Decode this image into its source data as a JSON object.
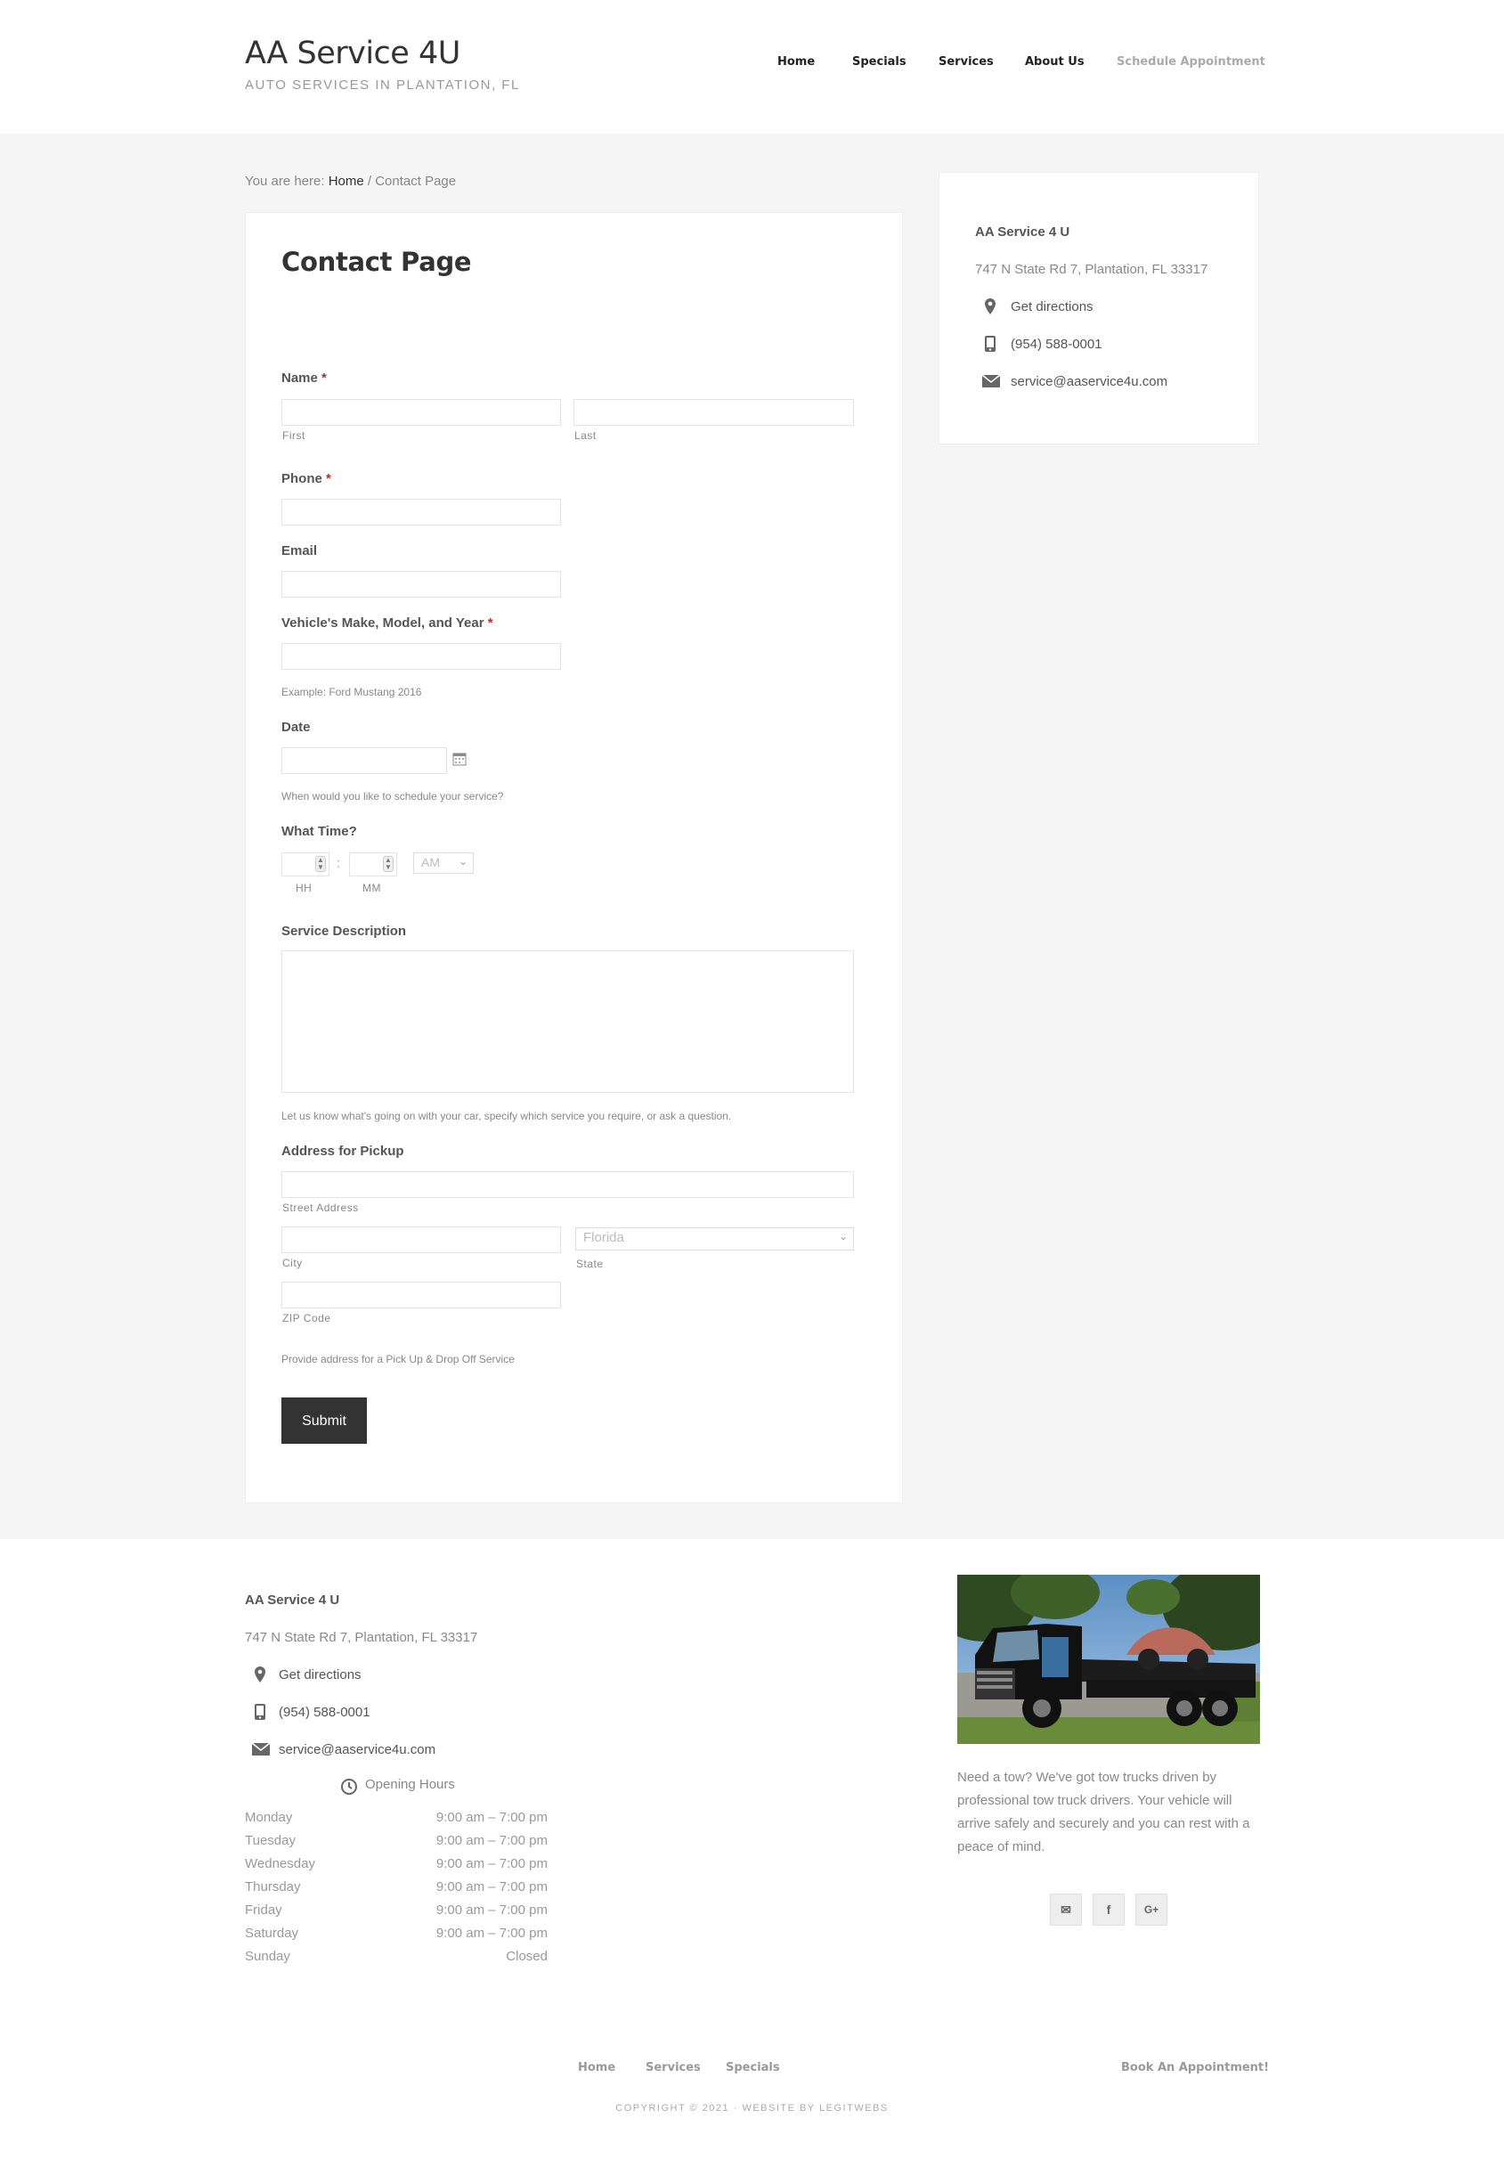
{
  "site": {
    "title": "AA Service 4U",
    "description": "AUTO SERVICES IN PLANTATION, FL"
  },
  "nav": {
    "items": [
      "Home",
      "Specials",
      "Services",
      "About Us",
      "Schedule Appointment"
    ]
  },
  "breadcrumb": {
    "prefix": "You are here: ",
    "home": "Home",
    "separator": " / ",
    "current": "Contact Page"
  },
  "page": {
    "title": "Contact Page"
  },
  "form": {
    "name_label": "Name",
    "required_mark": "*",
    "first_sub": "First",
    "last_sub": "Last",
    "phone_label": "Phone",
    "email_label": "Email",
    "vehicle_label": "Vehicle's Make, Model, and Year",
    "vehicle_hint": "Example: Ford Mustang 2016",
    "date_label": "Date",
    "date_hint": "When would you like to schedule your service?",
    "time_label": "What Time?",
    "time_separator": ":",
    "hh_sub": "HH",
    "mm_sub": "MM",
    "ampm_value": "AM",
    "desc_label": "Service Description",
    "desc_hint": "Let us know what's going on with your car, specify which service you require, or ask a question.",
    "address_label": "Address for Pickup",
    "street_sub": "Street Address",
    "city_sub": "City",
    "state_sub": "State",
    "state_value": "Florida",
    "zip_sub": "ZIP Code",
    "address_hint": "Provide address for a Pick Up & Drop Off Service",
    "submit_label": "Submit"
  },
  "business": {
    "name": "AA Service 4 U",
    "address": "747 N State Rd 7, Plantation, FL 33317",
    "directions": "Get directions",
    "phone": "(954) 588-0001",
    "email": "service@aaservice4u.com"
  },
  "hours": {
    "title": "Opening Hours",
    "rows": [
      {
        "day": "Monday",
        "time": "9:00 am – 7:00 pm"
      },
      {
        "day": "Tuesday",
        "time": "9:00 am – 7:00 pm"
      },
      {
        "day": "Wednesday",
        "time": "9:00 am – 7:00 pm"
      },
      {
        "day": "Thursday",
        "time": "9:00 am – 7:00 pm"
      },
      {
        "day": "Friday",
        "time": "9:00 am – 7:00 pm"
      },
      {
        "day": "Saturday",
        "time": "9:00 am – 7:00 pm"
      },
      {
        "day": "Sunday",
        "time": "Closed"
      }
    ]
  },
  "tow": {
    "text": "Need a tow? We've got tow trucks driven by professional tow truck drivers. Your vehicle will arrive safely and securely and you can rest with a peace of mind.",
    "social": [
      {
        "icon": "envelope-icon",
        "glyph": "✉"
      },
      {
        "icon": "facebook-icon",
        "glyph": "f"
      },
      {
        "icon": "google-plus-icon",
        "glyph": "G+"
      }
    ]
  },
  "footer": {
    "nav": [
      "Home",
      "Services",
      "Specials"
    ],
    "cta": "Book An Appointment!",
    "copyright": "COPYRIGHT © 2021 · WEBSITE BY LEGITWEBS"
  },
  "colors": {
    "band": "#f5f5f5",
    "button": "#333333",
    "required": "#b03030"
  }
}
